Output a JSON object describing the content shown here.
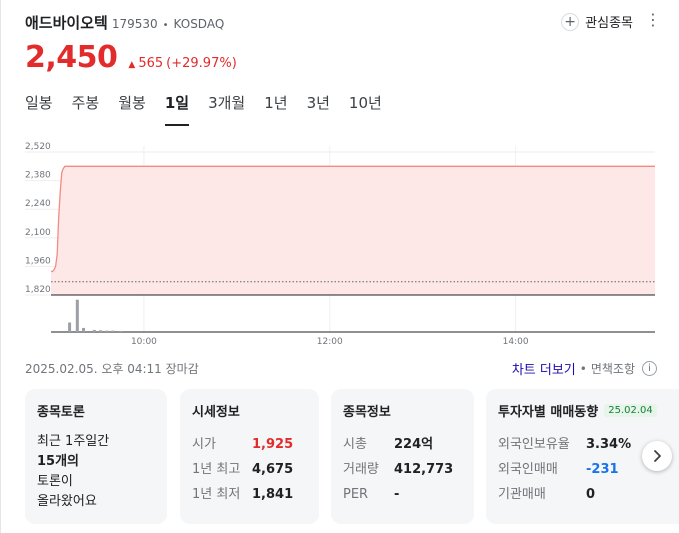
{
  "stock": {
    "name": "애드바이오텍",
    "code": "179530",
    "separator": "•",
    "market": "KOSDAQ",
    "price": "2,450",
    "change_arrow": "▲",
    "change_amount": "565",
    "change_percent": "(+29.97%)",
    "up_color": "#e22b2b"
  },
  "watch": {
    "plus": "+",
    "label": "관심종목",
    "more": "⋮"
  },
  "tabs": [
    {
      "label": "일봉",
      "active": false
    },
    {
      "label": "주봉",
      "active": false
    },
    {
      "label": "월봉",
      "active": false
    },
    {
      "label": "1일",
      "active": true
    },
    {
      "label": "3개월",
      "active": false
    },
    {
      "label": "1년",
      "active": false
    },
    {
      "label": "3년",
      "active": false
    },
    {
      "label": "10년",
      "active": false
    }
  ],
  "chart_data": {
    "type": "area",
    "y_ticks": [
      "2,520",
      "2,380",
      "2,240",
      "2,100",
      "1,960",
      "1,820"
    ],
    "y_tick_values": [
      2520,
      2380,
      2240,
      2100,
      1960,
      1820
    ],
    "x_ticks": [
      "10:00",
      "12:00",
      "14:00"
    ],
    "x_tick_minutes": [
      600,
      720,
      840
    ],
    "x_range_minutes": [
      540,
      930
    ],
    "ylim": [
      1820,
      2520
    ],
    "previous_close": 1885,
    "price_points": [
      {
        "t": 540,
        "v": 1935
      },
      {
        "t": 541,
        "v": 1935
      },
      {
        "t": 542,
        "v": 1945
      },
      {
        "t": 543,
        "v": 1960
      },
      {
        "t": 544,
        "v": 2020
      },
      {
        "t": 545,
        "v": 2200
      },
      {
        "t": 546,
        "v": 2330
      },
      {
        "t": 547,
        "v": 2420
      },
      {
        "t": 548,
        "v": 2440
      },
      {
        "t": 549,
        "v": 2450
      },
      {
        "t": 930,
        "v": 2450
      }
    ],
    "volume_bars": [
      {
        "t": 552,
        "h": 0.28
      },
      {
        "t": 557,
        "h": 0.95
      },
      {
        "t": 561,
        "h": 0.12
      },
      {
        "t": 568,
        "h": 0.06
      },
      {
        "t": 572,
        "h": 0.05
      },
      {
        "t": 576,
        "h": 0.04
      },
      {
        "t": 580,
        "h": 0.04
      },
      {
        "t": 585,
        "h": 0.03
      }
    ],
    "line_color": "#f28b82",
    "fill_color": "#fde8e7",
    "grid": true
  },
  "footer": {
    "timestamp": "2025.02.05. 오후 04:11 장마감",
    "chart_link": "차트 더보기",
    "sep": "•",
    "disclaimer": "면책조항",
    "info": "i"
  },
  "panels": {
    "discussion": {
      "title": "종목토론",
      "line1": "최근 1주일간",
      "count": "15개의",
      "line3": "토론이",
      "line4": "올라왔어요"
    },
    "market": {
      "title": "시세정보",
      "rows": [
        {
          "label": "시가",
          "value": "1,925"
        },
        {
          "label": "1년 최고",
          "value": "4,675"
        },
        {
          "label": "1년 최저",
          "value": "1,841"
        }
      ]
    },
    "info": {
      "title": "종목정보",
      "rows": [
        {
          "label": "시총",
          "value": "224억"
        },
        {
          "label": "거래량",
          "value": "412,773"
        },
        {
          "label": "PER",
          "value": "-"
        }
      ]
    },
    "investor": {
      "title": "투자자별 매매동향",
      "date": "25.02.04",
      "rows": [
        {
          "label": "외국인보유율",
          "value": "3.34%"
        },
        {
          "label": "외국인매매",
          "value": "-231"
        },
        {
          "label": "기관매매",
          "value": "0"
        }
      ]
    }
  },
  "next_icon": "chevron-right"
}
